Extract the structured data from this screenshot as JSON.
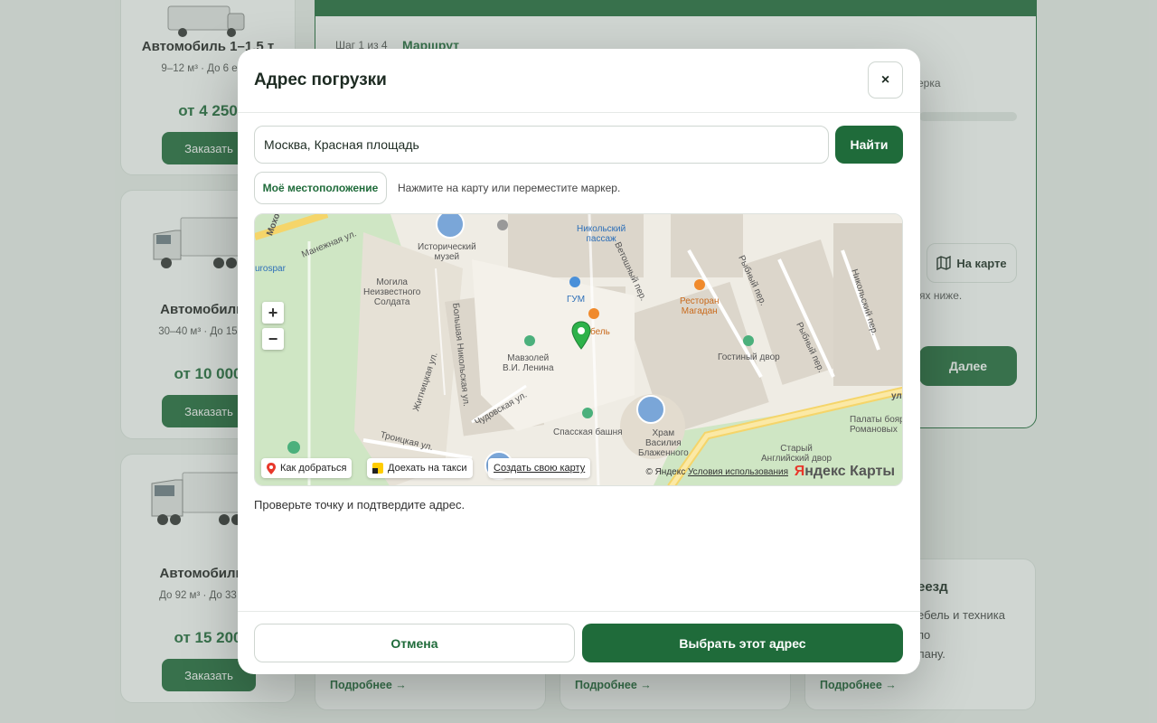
{
  "background": {
    "vehicles": [
      {
        "title": "Автомобиль 1–1,5 т",
        "subtitle": "9–12 м³ · До 6 евро",
        "price": "от 4 250",
        "order_label": "Заказать"
      },
      {
        "title": "Автомобиль 3",
        "subtitle": "30–40 м³ · До 15 евр",
        "price": "от 10 000",
        "order_label": "Заказать"
      },
      {
        "title": "Автомобиль д",
        "subtitle": "До 92 м³ · До 33 евр",
        "price": "от 15 200",
        "order_label": "Заказать"
      }
    ],
    "wizard": {
      "step_counter": "Шаг 1 из 4",
      "step_name": "Маршрут",
      "partial_text_1": "ерка",
      "map_button_label": "На карте",
      "partial_text_2": "ях ниже.",
      "next_label": "Далее"
    },
    "services": [
      {
        "more_label": "Подробнее →"
      },
      {
        "more_label": "Подробнее →"
      },
      {
        "title": "еезд",
        "text_lines": [
          "ебель и техника",
          "по",
          "лану."
        ],
        "more_label": "Подробнее →"
      }
    ]
  },
  "modal": {
    "title": "Адрес погрузки",
    "close_label": "×",
    "address_value": "Москва, Красная площадь",
    "find_label": "Найти",
    "geo_label": "Моё местоположение",
    "hint": "Нажмите на карту или переместите маркер.",
    "map": {
      "labels": {
        "historical_museum": "Исторический\nмузей",
        "nikolsky": "Никольский\nпассаж",
        "gum": "ГУМ",
        "restaurant": "Ресторан\nМагадан",
        "tomb": "Могила\nНеизвестного\nСолдата",
        "mausoleum": "Мавзолей\nВ.И. Ленина",
        "gostiny": "Гостиный двор",
        "spasskaya": "Спасская башня",
        "basil": "Храм\nВасилия\nБлаженного",
        "old_english": "Старый\nАнглийский двор",
        "chambers": "Палаты бояр\nРомановых",
        "bel": "бель",
        "manezhnaya": "Манежная ул.",
        "mokhovaya": "Мохо",
        "eurospar": "urospar",
        "b_nikolskaya": "Большая Никольская ул.",
        "zhitnitskaya": "Житницкая ул.",
        "chudovskaya": "Чудовская ул.",
        "troitskaya": "Троицкая ул.",
        "vetoshny": "Ветошный пер.",
        "rybny": "Рыбный пер.",
        "rybny2": "Рыбный пер.",
        "nikolsky_per": "Никольский пер.",
        "ul": "ул"
      },
      "zoom_in": "+",
      "zoom_out": "−",
      "route_label": "Как добраться",
      "taxi_label": "Доехать на такси",
      "create_map_label": "Создать свою карту",
      "copyright": "© Яндекс",
      "terms": "Условия использования",
      "logo_y": "Я",
      "logo_rest": "ндекс Карты"
    },
    "confirm_text": "Проверьте точку и подтвердите адрес.",
    "cancel_label": "Отмена",
    "choose_label": "Выбрать этот адрес"
  }
}
